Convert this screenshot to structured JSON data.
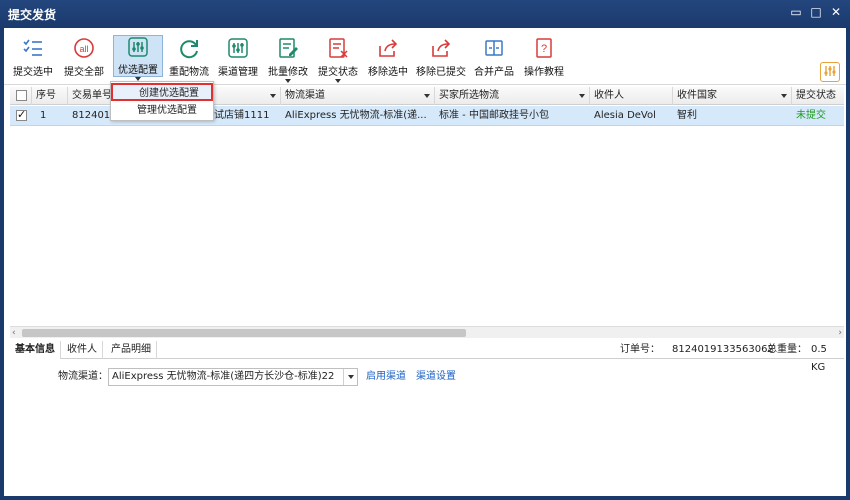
{
  "window": {
    "title": "提交发货",
    "minimize": "▭",
    "maximize": "□",
    "close": "✕"
  },
  "toolbar": {
    "buttons": [
      {
        "label": "提交选中",
        "icon": "checklist-icon"
      },
      {
        "label": "提交全部",
        "icon": "all-icon"
      },
      {
        "label": "优选配置",
        "icon": "sliders-icon"
      },
      {
        "label": "重配物流",
        "icon": "refresh-icon"
      },
      {
        "label": "渠道管理",
        "icon": "channel-icon"
      },
      {
        "label": "批量修改",
        "icon": "edit-icon"
      },
      {
        "label": "提交状态",
        "icon": "status-icon"
      },
      {
        "label": "移除选中",
        "icon": "share-icon"
      },
      {
        "label": "移除已提交",
        "icon": "share-icon"
      },
      {
        "label": "合并产品",
        "icon": "merge-icon"
      },
      {
        "label": "操作教程",
        "icon": "help-icon"
      }
    ],
    "all_icon_text": "all"
  },
  "menu": {
    "items": [
      "创建优选配置",
      "管理优选配置"
    ]
  },
  "grid": {
    "columns": [
      "序号",
      "交易单号",
      "物流渠道",
      "买家所选物流",
      "收件人",
      "收件国家",
      "提交状态"
    ],
    "rows": [
      {
        "seq": "1",
        "trade_no": "8124019",
        "store": "试店铺1111",
        "channel": "AliExpress 无忧物流-标准(递...",
        "buyer_logistics": "标准 - 中国邮政挂号小包",
        "recipient": "Alesia DeVol",
        "country": "智利",
        "status": "未提交"
      }
    ]
  },
  "bottom": {
    "tabs": [
      "基本信息",
      "收件人",
      "产品明细"
    ],
    "order_label": "订单号：",
    "order_no": "8124019133563062",
    "weight_label": "总重量：",
    "weight": "0.5 KG"
  },
  "detail": {
    "channel_label": "物流渠道：",
    "channel_value": "AliExpress 无忧物流-标准(递四方长沙仓-标准)22",
    "enable_link": "启用渠道",
    "settings_link": "渠道设置"
  },
  "colors": {
    "titlebar": "#1b3a6c",
    "selected_row": "#d5e9fb",
    "status_green": "#1f9a1f",
    "link": "#1a62c5",
    "menu_highlight_border": "#e03030"
  }
}
